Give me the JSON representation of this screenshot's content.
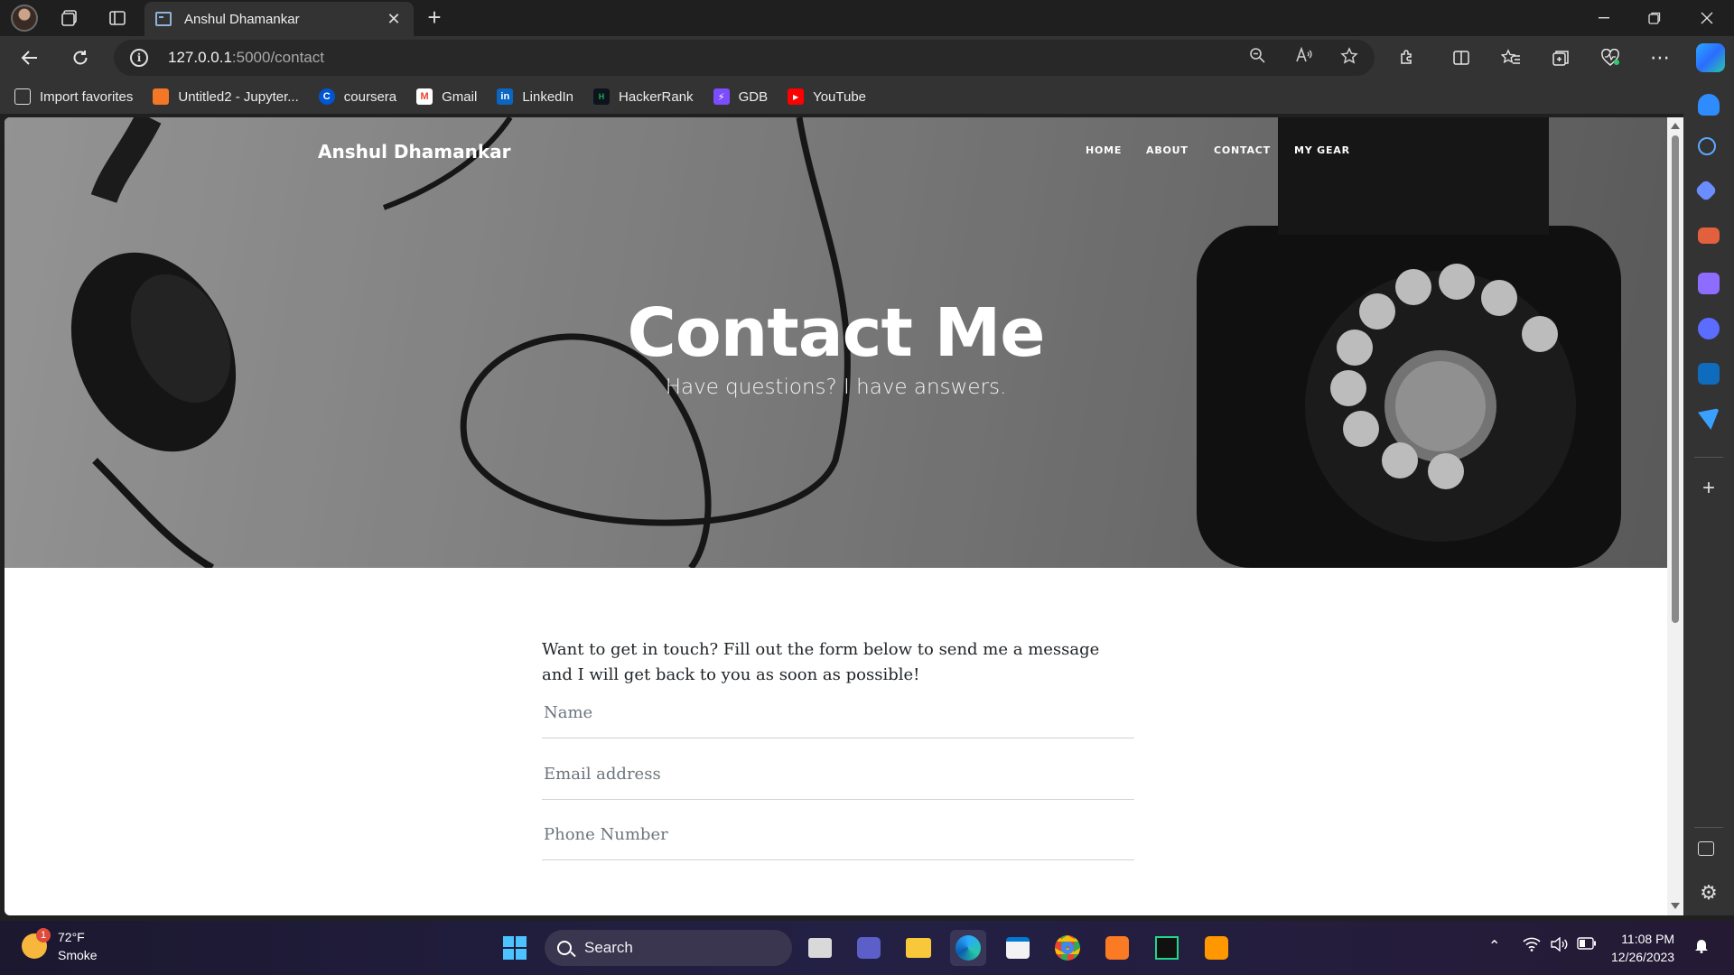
{
  "browser": {
    "tab_title": "Anshul Dhamankar",
    "new_tab_symbol": "+",
    "url_host": "127.0.0.1",
    "url_path": ":5000/contact",
    "bookmarks": [
      {
        "label": "Import favorites",
        "icon": "import-icon",
        "color": "#3a3a3a"
      },
      {
        "label": "Untitled2 - Jupyter...",
        "icon": "jupyter-icon",
        "color": "#f37726"
      },
      {
        "label": "coursera",
        "icon": "coursera-icon",
        "color": "#0056d2"
      },
      {
        "label": "Gmail",
        "icon": "gmail-icon",
        "color": "#ea4335"
      },
      {
        "label": "LinkedIn",
        "icon": "linkedin-icon",
        "color": "#0a66c2"
      },
      {
        "label": "HackerRank",
        "icon": "hackerrank-icon",
        "color": "#1ba94c"
      },
      {
        "label": "GDB",
        "icon": "gdb-icon",
        "color": "#7b4dff"
      },
      {
        "label": "YouTube",
        "icon": "youtube-icon",
        "color": "#ff0000"
      }
    ]
  },
  "site": {
    "brand": "Anshul Dhamankar",
    "nav": [
      "HOME",
      "ABOUT",
      "CONTACT",
      "MY GEAR"
    ],
    "hero_title": "Contact Me",
    "hero_subtitle": "Have questions? I have answers.",
    "intro": "Want to get in touch? Fill out the form below to send me a message and I will get back to you as soon as possible!",
    "fields": [
      {
        "placeholder": "Name"
      },
      {
        "placeholder": "Email address"
      },
      {
        "placeholder": "Phone Number"
      }
    ]
  },
  "taskbar": {
    "weather_temp": "72°F",
    "weather_desc": "Smoke",
    "weather_badge": "1",
    "search_label": "Search",
    "time": "11:08 PM",
    "date": "12/26/2023"
  },
  "colors": {
    "accent": "#0078d4",
    "page_text": "#212529",
    "placeholder": "#6c757d"
  }
}
